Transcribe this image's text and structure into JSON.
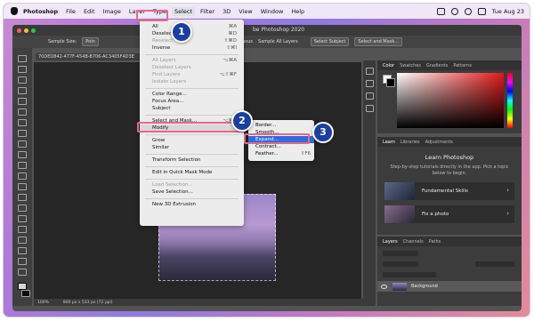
{
  "menubar": {
    "app": "Photoshop",
    "items": [
      "File",
      "Edit",
      "Image",
      "Layer",
      "Type",
      "Select",
      "Filter",
      "3D",
      "View",
      "Window",
      "Help"
    ],
    "datetime": "Tue Aug 23"
  },
  "window": {
    "title": "be Photoshop 2020",
    "doc_tab": "70DED842-477F-454B-B706-AC3405F4D3E"
  },
  "options": {
    "sample_size_label": "Sample Size:",
    "sample_size_value": "Poin",
    "contiguous": "Contiguous",
    "sample_all_layers": "Sample All Layers",
    "select_subject": "Select Subject",
    "select_and_mask": "Select and Mask..."
  },
  "status": {
    "zoom": "100%",
    "size": "800 px x 533 px (72 ppi)"
  },
  "select_menu": {
    "items": [
      {
        "label": "All",
        "shortcut": "⌘A",
        "disabled": false
      },
      {
        "label": "Deselect",
        "shortcut": "⌘D",
        "disabled": false
      },
      {
        "label": "Reselect",
        "shortcut": "⇧⌘D",
        "disabled": true
      },
      {
        "label": "Inverse",
        "shortcut": "⇧⌘I",
        "disabled": false
      },
      {
        "label": "All Layers",
        "shortcut": "⌥⌘A",
        "disabled": true
      },
      {
        "label": "Deselect Layers",
        "shortcut": "",
        "disabled": true
      },
      {
        "label": "Find Layers",
        "shortcut": "⌥⇧⌘F",
        "disabled": true
      },
      {
        "label": "Isolate Layers",
        "shortcut": "",
        "disabled": true
      },
      {
        "label": "Color Range...",
        "shortcut": "",
        "disabled": false
      },
      {
        "label": "Focus Area...",
        "shortcut": "",
        "disabled": false
      },
      {
        "label": "Subject",
        "shortcut": "",
        "disabled": false
      },
      {
        "label": "Select and Mask...",
        "shortcut": "⌥⌘R",
        "disabled": false
      },
      {
        "label": "Modify",
        "shortcut": "",
        "disabled": false
      },
      {
        "label": "Grow",
        "shortcut": "",
        "disabled": false
      },
      {
        "label": "Similar",
        "shortcut": "",
        "disabled": false
      },
      {
        "label": "Transform Selection",
        "shortcut": "",
        "disabled": false
      },
      {
        "label": "Edit in Quick Mask Mode",
        "shortcut": "",
        "disabled": false
      },
      {
        "label": "Load Selection...",
        "shortcut": "",
        "disabled": true
      },
      {
        "label": "Save Selection...",
        "shortcut": "",
        "disabled": false
      },
      {
        "label": "New 3D Extrusion",
        "shortcut": "",
        "disabled": false
      }
    ]
  },
  "modify_submenu": {
    "items": [
      {
        "label": "Border...",
        "shortcut": ""
      },
      {
        "label": "Smooth...",
        "shortcut": ""
      },
      {
        "label": "Expand...",
        "shortcut": ""
      },
      {
        "label": "Contract...",
        "shortcut": ""
      },
      {
        "label": "Feather...",
        "shortcut": "⇧F6"
      }
    ]
  },
  "panels": {
    "color_tabs": [
      "Color",
      "Swatches",
      "Gradients",
      "Patterns"
    ],
    "learn_tabs": [
      "Learn",
      "Libraries",
      "Adjustments"
    ],
    "learn_title": "Learn Photoshop",
    "learn_sub": "Step-by-step tutorials directly in the app. Pick a topic below to begin.",
    "cards": [
      "Fundamental Skills",
      "Fix a photo"
    ],
    "layers_tabs": [
      "Layers",
      "Channels",
      "Paths"
    ],
    "layer_name": "Background"
  },
  "badges": [
    "1",
    "2",
    "3"
  ],
  "colors": {
    "highlight": "#e06a8a",
    "badge": "#1a3fa0",
    "menu_active": "#2f6cdb"
  }
}
